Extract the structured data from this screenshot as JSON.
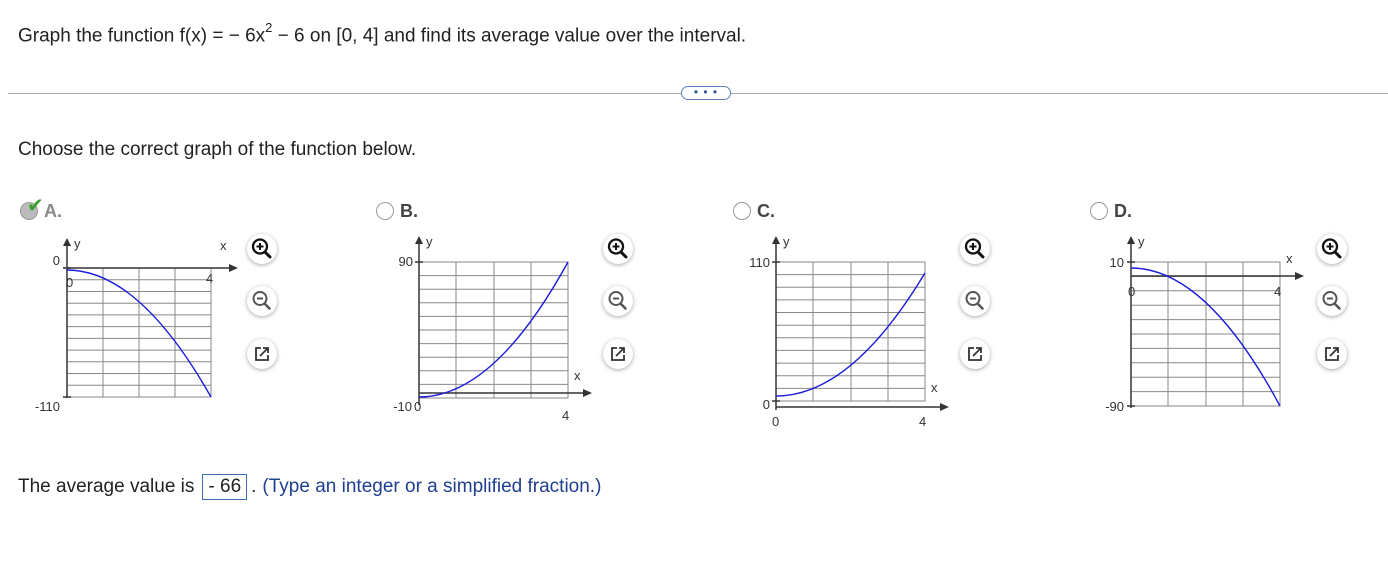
{
  "question": {
    "prefix": "Graph the function f(x) = − 6x",
    "exponent": "2",
    "suffix": " − 6 on [0, 4] and find its average value over the interval."
  },
  "more_button": {
    "label": "• • •"
  },
  "instruction": "Choose the correct graph of the function below.",
  "choices": [
    {
      "letter": "A.",
      "selected": true,
      "y_label": "y",
      "x_label": "x",
      "y_top": "0",
      "y_bottom": "-110",
      "x_origin": "0",
      "x_end": "4"
    },
    {
      "letter": "B.",
      "selected": false,
      "y_label": "y",
      "x_label": "x",
      "y_top": "90",
      "y_bottom": "-10",
      "x_origin": "0",
      "x_end": "4"
    },
    {
      "letter": "C.",
      "selected": false,
      "y_label": "y",
      "x_label": "x",
      "y_top": "110",
      "y_bottom": "0",
      "x_origin": "0",
      "x_end": "4"
    },
    {
      "letter": "D.",
      "selected": false,
      "y_label": "y",
      "x_label": "x",
      "y_top": "10",
      "y_bottom": "-90",
      "x_origin": "0",
      "x_end": "4"
    }
  ],
  "answer": {
    "prefix": "The average value is",
    "value": "- 66",
    "period": ".",
    "hint": "(Type an integer or a simplified fraction.)"
  },
  "colors": {
    "curve": "#1a1adc",
    "grid": "#888888",
    "check": "#3aa02f",
    "hint": "#1f3f8f"
  },
  "icons": [
    "zoom-in-icon",
    "zoom-out-icon",
    "open-new-window-icon",
    "checkmark-icon"
  ]
}
